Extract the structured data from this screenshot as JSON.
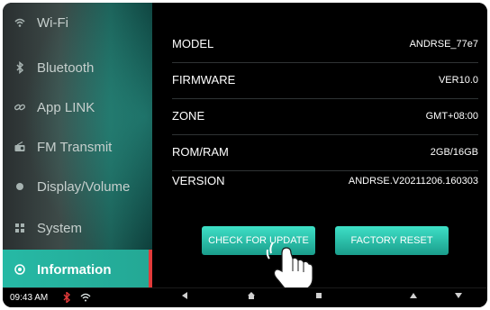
{
  "sidebar": {
    "items": [
      {
        "label": "Wi-Fi",
        "icon": "wifi-icon"
      },
      {
        "label": "Bluetooth",
        "icon": "bluetooth-icon"
      },
      {
        "label": "App LINK",
        "icon": "link-icon"
      },
      {
        "label": "FM Transmit",
        "icon": "radio-icon"
      },
      {
        "label": "Display/Volume",
        "icon": "display-icon"
      },
      {
        "label": "System",
        "icon": "system-icon"
      },
      {
        "label": "Information",
        "icon": "info-icon"
      }
    ],
    "active_index": 6
  },
  "info": {
    "rows": [
      {
        "key": "MODEL",
        "value": "ANDRSE_77e7"
      },
      {
        "key": "FIRMWARE",
        "value": "VER10.0"
      },
      {
        "key": "ZONE",
        "value": "GMT+08:00"
      },
      {
        "key": "ROM/RAM",
        "value": "2GB/16GB"
      },
      {
        "key": "VERSION",
        "value": "ANDRSE.V20211206.160303"
      }
    ]
  },
  "buttons": {
    "check_update": "CHECK FOR UPDATE",
    "factory_reset": "FACTORY RESET"
  },
  "statusbar": {
    "time": "09:43 AM",
    "icons": [
      "bluetooth-icon",
      "wifi-icon"
    ]
  },
  "navbar": {
    "icons": [
      "back-icon",
      "home-icon",
      "recents-icon",
      "volume-down-icon",
      "volume-up-icon"
    ]
  },
  "colors": {
    "accent": "#26b9a5",
    "active_marker": "#e23a3a",
    "background": "#000000"
  }
}
